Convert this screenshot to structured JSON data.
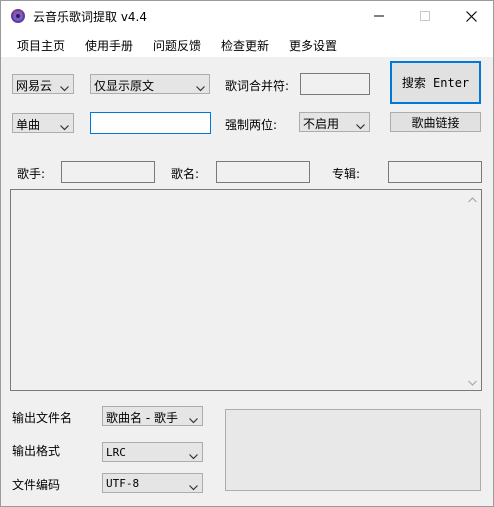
{
  "window": {
    "title": "云音乐歌词提取 v4.4",
    "icon": "app-logo-icon",
    "controls": [
      "minimize-icon",
      "maximize-icon",
      "close-icon"
    ]
  },
  "menu": [
    "项目主页",
    "使用手册",
    "问题反馈",
    "检查更新",
    "更多设置"
  ],
  "search": {
    "platform": "网易云",
    "display_mode": "仅显示原文",
    "merge_label": "歌词合并符:",
    "merge_value": "",
    "search_type": "单曲",
    "query": "",
    "force_two_digit_label": "强制两位:",
    "force_two_digit_value": "不启用",
    "search_button": "搜索 Enter",
    "song_link_button": "歌曲链接"
  },
  "info": {
    "artist_label": "歌手:",
    "artist_value": "",
    "song_label": "歌名:",
    "song_value": "",
    "album_label": "专辑:",
    "album_value": ""
  },
  "lyrics": {
    "content": ""
  },
  "output": {
    "filename_label": "输出文件名",
    "filename_value": "歌曲名 - 歌手",
    "format_label": "输出格式",
    "format_value": "LRC",
    "encoding_label": "文件编码",
    "encoding_value": "UTF-8"
  },
  "colors": {
    "accent": "#0078d7",
    "window_bg": "#f0f0f0"
  }
}
